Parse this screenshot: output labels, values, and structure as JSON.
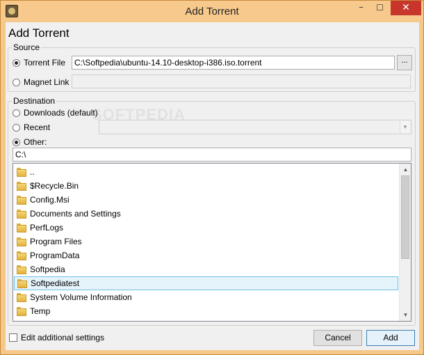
{
  "window": {
    "title": "Add Torrent",
    "minimize_glyph": "–",
    "maximize_glyph": "☐",
    "close_glyph": "✕",
    "close_color": "#c7352b",
    "frame_color": "#f7c98c"
  },
  "heading": "Add Torrent",
  "source": {
    "legend": "Source",
    "torrent_file_label": "Torrent File",
    "torrent_file_value": "C:\\Softpedia\\ubuntu-14.10-desktop-i386.iso.torrent",
    "browse_label": "...",
    "magnet_link_label": "Magnet Link",
    "magnet_link_value": ""
  },
  "destination": {
    "legend": "Destination",
    "downloads_label": "Downloads (default)",
    "recent_label": "Recent",
    "recent_value": "",
    "other_label": "Other:",
    "path_value": "C:\\",
    "selected_option": "Other:",
    "folders": [
      "..",
      "$Recycle.Bin",
      "Config.Msi",
      "Documents and Settings",
      "PerfLogs",
      "Program Files",
      "ProgramData",
      "Softpedia",
      "Softpediatest",
      "System Volume Information",
      "Temp"
    ],
    "selected_folder": "Softpediatest",
    "selection_color": "#e5f3fb"
  },
  "watermark": "SOFTPEDIA",
  "footer": {
    "edit_settings_label": "Edit additional settings",
    "edit_settings_checked": false,
    "cancel_label": "Cancel",
    "add_label": "Add"
  }
}
